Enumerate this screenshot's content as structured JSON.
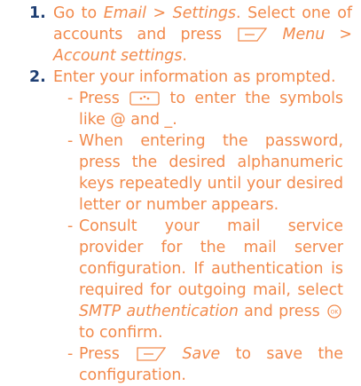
{
  "steps": [
    {
      "number": "1.",
      "parts": {
        "a": "Go to ",
        "b": "Email > Settings",
        "c": ". Select one of accounts and press ",
        "d": "Menu > Account settings",
        "e": "."
      }
    },
    {
      "number": "2.",
      "text": "Enter your information as prompted."
    }
  ],
  "bullets": [
    {
      "dash": "-",
      "a": "Press ",
      "b": " to enter the symbols like @ and _."
    },
    {
      "dash": "-",
      "text": "When entering the password, press the desired alphanumeric keys repeatedly until your desired letter or number appears."
    },
    {
      "dash": "-",
      "a": "Consult your mail service provider for the mail server configuration. If authentication is required for outgoing mail, select ",
      "b": "SMTP authentication",
      "c": " and press ",
      "d": " to confirm."
    },
    {
      "dash": "-",
      "a": "Press ",
      "b": "Save",
      "c": " to save the configuration."
    }
  ],
  "icons": {
    "softkey": "left-softkey-icon",
    "symbol": "symbol-key-icon",
    "ok": "ok-key-icon"
  },
  "colors": {
    "text": "#f28a4c",
    "step_number": "#1f3f73"
  }
}
